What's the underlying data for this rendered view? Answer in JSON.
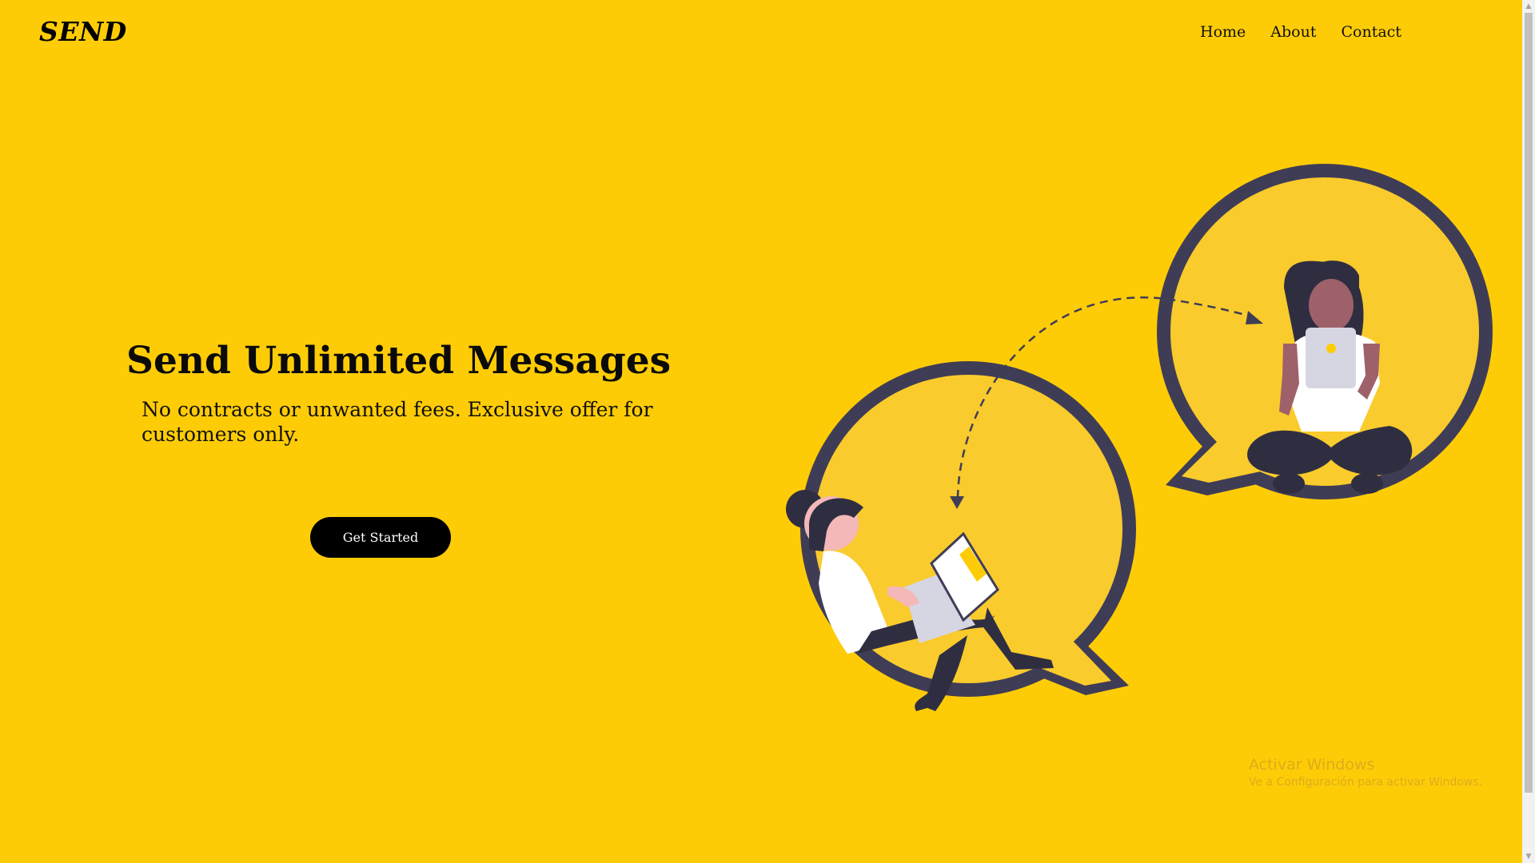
{
  "header": {
    "logo": "SEND",
    "nav": [
      {
        "label": "Home"
      },
      {
        "label": "About"
      },
      {
        "label": "Contact"
      }
    ]
  },
  "hero": {
    "title": "Send Unlimited Messages",
    "subtitle": "No contracts or unwanted fees. Exclusive offer for customers only.",
    "cta_label": "Get Started"
  },
  "illustration": {
    "name": "two-people-messaging",
    "colors": {
      "background": "#fecc06",
      "bubble_fill": "#f9cb2c",
      "bubble_outline": "#3f3d56",
      "shadow": "#e0b62a"
    }
  },
  "watermark": {
    "title": "Activar Windows",
    "subtitle": "Ve a Configuración para activar Windows."
  },
  "scrollbar": {
    "up_icon": "▲",
    "down_icon": "▼"
  }
}
